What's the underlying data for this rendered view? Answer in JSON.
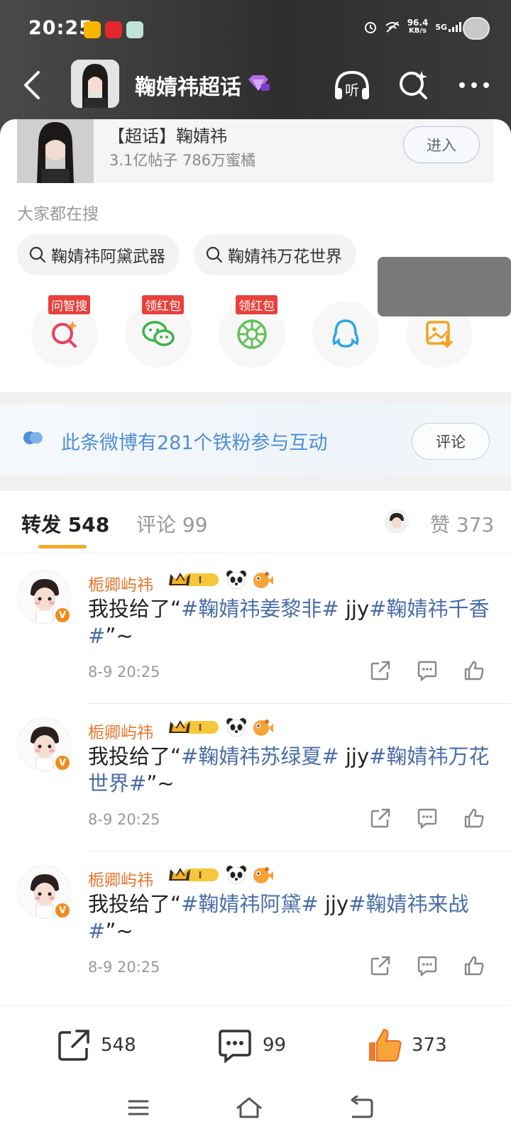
{
  "status_bar": {
    "time": "20:25",
    "network_speed": "96.4",
    "network_unit": "KB/s",
    "signal": "5G"
  },
  "header": {
    "title": "鞠婧祎超话",
    "listen_label": "听"
  },
  "topic_card": {
    "name": "【超话】鞠婧祎",
    "stats": "3.1亿帖子 786万蜜橘",
    "enter_label": "进入"
  },
  "search": {
    "label": "大家都在搜",
    "chips": [
      "鞠婧祎阿黛武器",
      "鞠婧祎万花世界"
    ]
  },
  "share_items": [
    {
      "tag": "问智搜",
      "icon": "smart-search-icon"
    },
    {
      "tag": "领红包",
      "icon": "wechat-icon"
    },
    {
      "tag": "领红包",
      "icon": "moments-icon"
    },
    {
      "tag": "",
      "icon": "qq-icon"
    },
    {
      "tag": "",
      "icon": "save-image-icon"
    }
  ],
  "fans_banner": {
    "text": "此条微博有281个铁粉参与互动",
    "button": "评论"
  },
  "tabs": {
    "repost": "转发 548",
    "comment": "评论 99",
    "like": "赞 373"
  },
  "posts": [
    {
      "user": "栀卿屿祎",
      "prefix": "我投给了“",
      "tag1": "#鞠婧祎姜黎非#",
      "middle": " jjy",
      "tag2": "#鞠婧祎千香#",
      "suffix": "”~",
      "time": "8-9 20:25"
    },
    {
      "user": "栀卿屿祎",
      "prefix": "我投给了“",
      "tag1": "#鞠婧祎苏绿夏#",
      "middle": " jjy",
      "tag2": "#鞠婧祎万花世界#",
      "suffix": "”~",
      "time": "8-9 20:25"
    },
    {
      "user": "栀卿屿祎",
      "prefix": "我投给了“",
      "tag1": "#鞠婧祎阿黛#",
      "middle": " jjy",
      "tag2": "#鞠婧祎来战#",
      "suffix": "”~",
      "time": "8-9 20:25"
    }
  ],
  "bottom_bar": {
    "repost_count": "548",
    "comment_count": "99",
    "like_count": "373"
  },
  "colors": {
    "accent_orange": "#f7a826",
    "username_orange": "#e4762c",
    "topic_blue": "#4a6ea8",
    "banner_blue": "#4e8fd6"
  }
}
